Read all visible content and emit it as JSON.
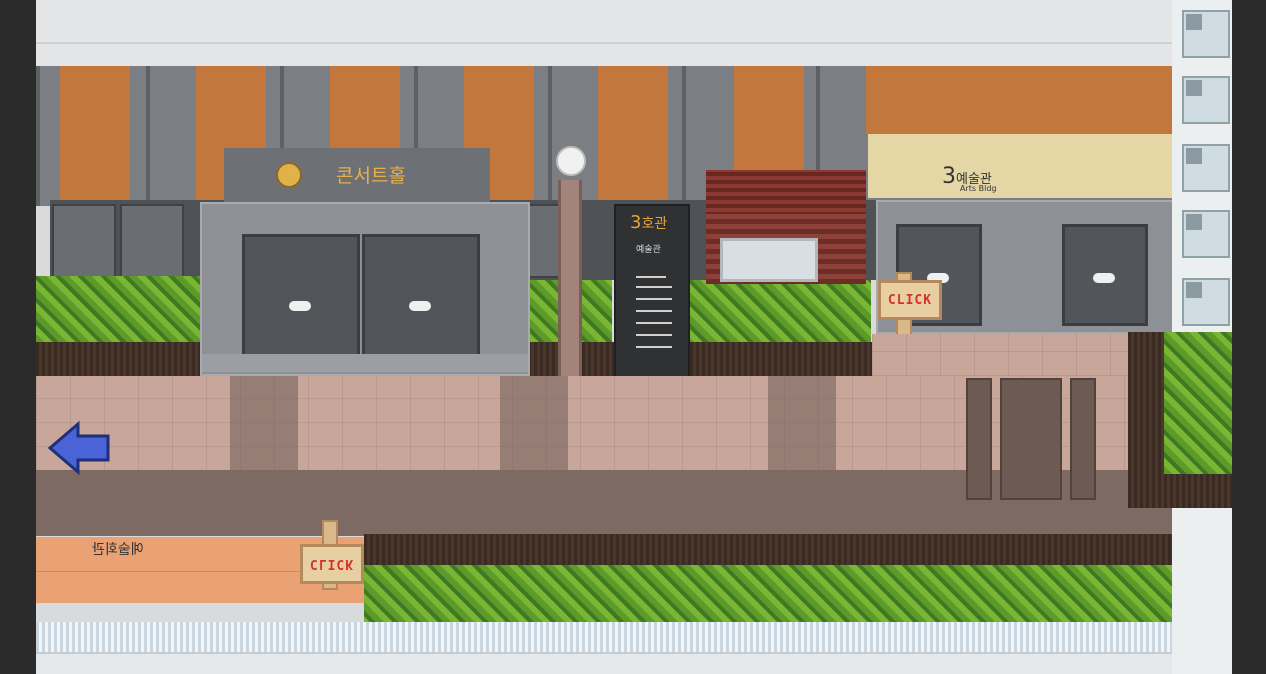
{
  "scene": {
    "concert_hall": {
      "label": "콘서트홀"
    },
    "building_3": {
      "number": "3",
      "label": "호관",
      "sub": "예술관"
    },
    "arts_building": {
      "number": "3",
      "label": "예술관",
      "sub": "Arts Bldg"
    },
    "plaza_sign": {
      "label": "예술회관"
    },
    "click_sign_1": {
      "label": "CLICK"
    },
    "click_sign_2": {
      "label": "CLICK"
    }
  },
  "colors": {
    "orange": "#c2773d",
    "arrow": "#4a63d6",
    "click_text": "#d2332b"
  },
  "icons": {
    "back": "left-arrow-icon"
  }
}
